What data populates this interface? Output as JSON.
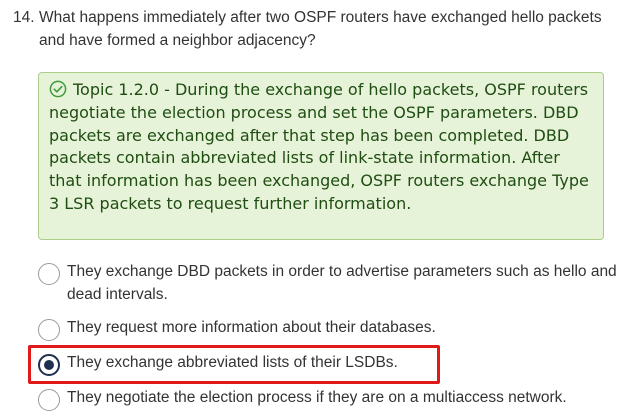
{
  "question": {
    "number": "14.",
    "text": "What happens immediately after two OSPF routers have exchanged hello packets and have formed a neighbor adjacency?"
  },
  "feedback": {
    "icon": "check-circle-icon",
    "text": "Topic 1.2.0 - During the exchange of hello packets, OSPF routers negotiate the election process and set the OSPF parameters. DBD packets are exchanged after that step has been completed. DBD packets contain abbreviated lists of link-state information. After that information has been exchanged, OSPF routers exchange Type 3 LSR packets to request further information."
  },
  "options": [
    {
      "label": "They exchange DBD packets in order to advertise parameters such as hello and dead intervals.",
      "selected": false
    },
    {
      "label": "They request more information about their databases.",
      "selected": false
    },
    {
      "label": "They exchange abbreviated lists of their LSDBs.",
      "selected": true
    },
    {
      "label": "They negotiate the election process if they are on a multiaccess network.",
      "selected": false
    }
  ],
  "colors": {
    "feedback_bg": "#e6f3d8",
    "feedback_text": "#1f4d12",
    "highlight": "#e01919",
    "selected_radio": "#1f2f4f"
  }
}
